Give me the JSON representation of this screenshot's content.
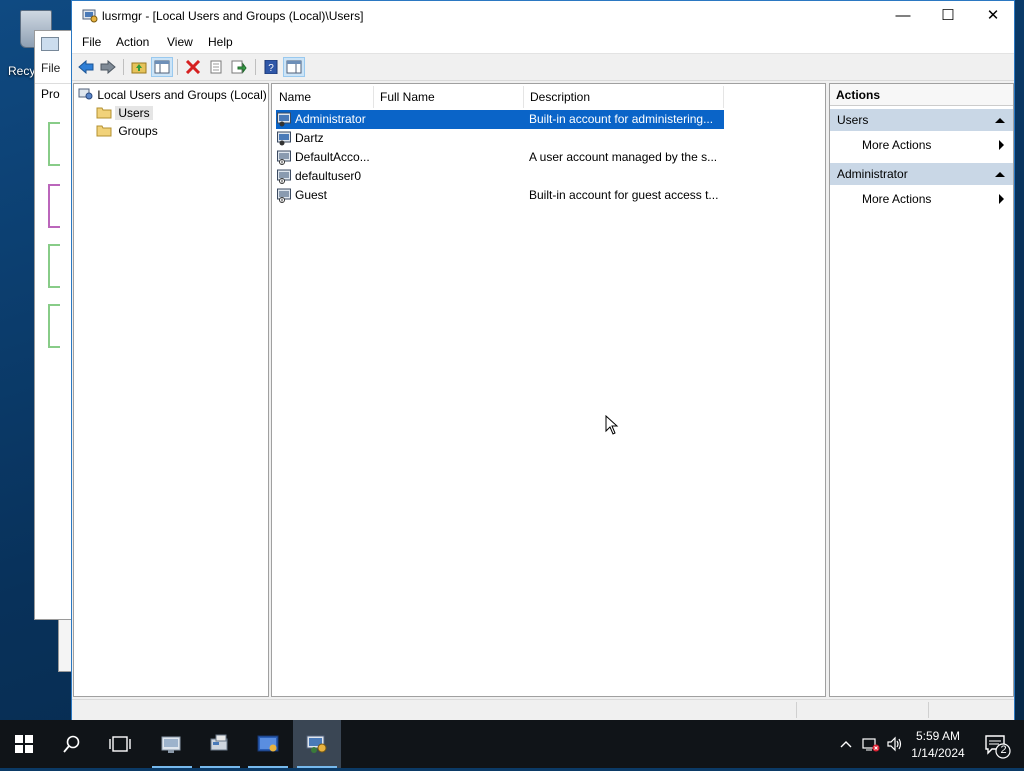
{
  "desktop": {
    "recycle_label": "Recy"
  },
  "bg_windows": {
    "menu_file": "File",
    "pro_label": "Pro"
  },
  "window": {
    "title": "lusrmgr - [Local Users and Groups (Local)\\Users]",
    "controls": {
      "minimize": "—",
      "maximize": "☐",
      "close": "✕"
    }
  },
  "menu": [
    "File",
    "Action",
    "View",
    "Help"
  ],
  "toolbar": [
    "back",
    "forward",
    "up-one-level",
    "show-hide-console-tree",
    "delete",
    "properties",
    "export-list",
    "help",
    "show-hide-action-pane"
  ],
  "tree": {
    "root": "Local Users and Groups (Local)",
    "children": [
      "Users",
      "Groups"
    ],
    "selected": "Users"
  },
  "list": {
    "columns": [
      "Name",
      "Full Name",
      "Description"
    ],
    "rows": [
      {
        "name": "Administrator",
        "full_name": "",
        "description": "Built-in account for administering...",
        "selected": true
      },
      {
        "name": "Dartz",
        "full_name": "",
        "description": ""
      },
      {
        "name": "DefaultAcco...",
        "full_name": "",
        "description": "A user account managed by the s..."
      },
      {
        "name": "defaultuser0",
        "full_name": "",
        "description": ""
      },
      {
        "name": "Guest",
        "full_name": "",
        "description": "Built-in account for guest access t..."
      }
    ]
  },
  "actions": {
    "header": "Actions",
    "sections": [
      {
        "title": "Users",
        "items": [
          "More Actions"
        ]
      },
      {
        "title": "Administrator",
        "items": [
          "More Actions"
        ]
      }
    ]
  },
  "taskbar": {
    "clock_time": "5:59 AM",
    "clock_date": "1/14/2024",
    "notification_count": "2"
  },
  "colors": {
    "selection": "#0a64c8",
    "action_section": "#c9d7e6",
    "taskbar": "#101418",
    "window_border": "#2b78c2"
  }
}
